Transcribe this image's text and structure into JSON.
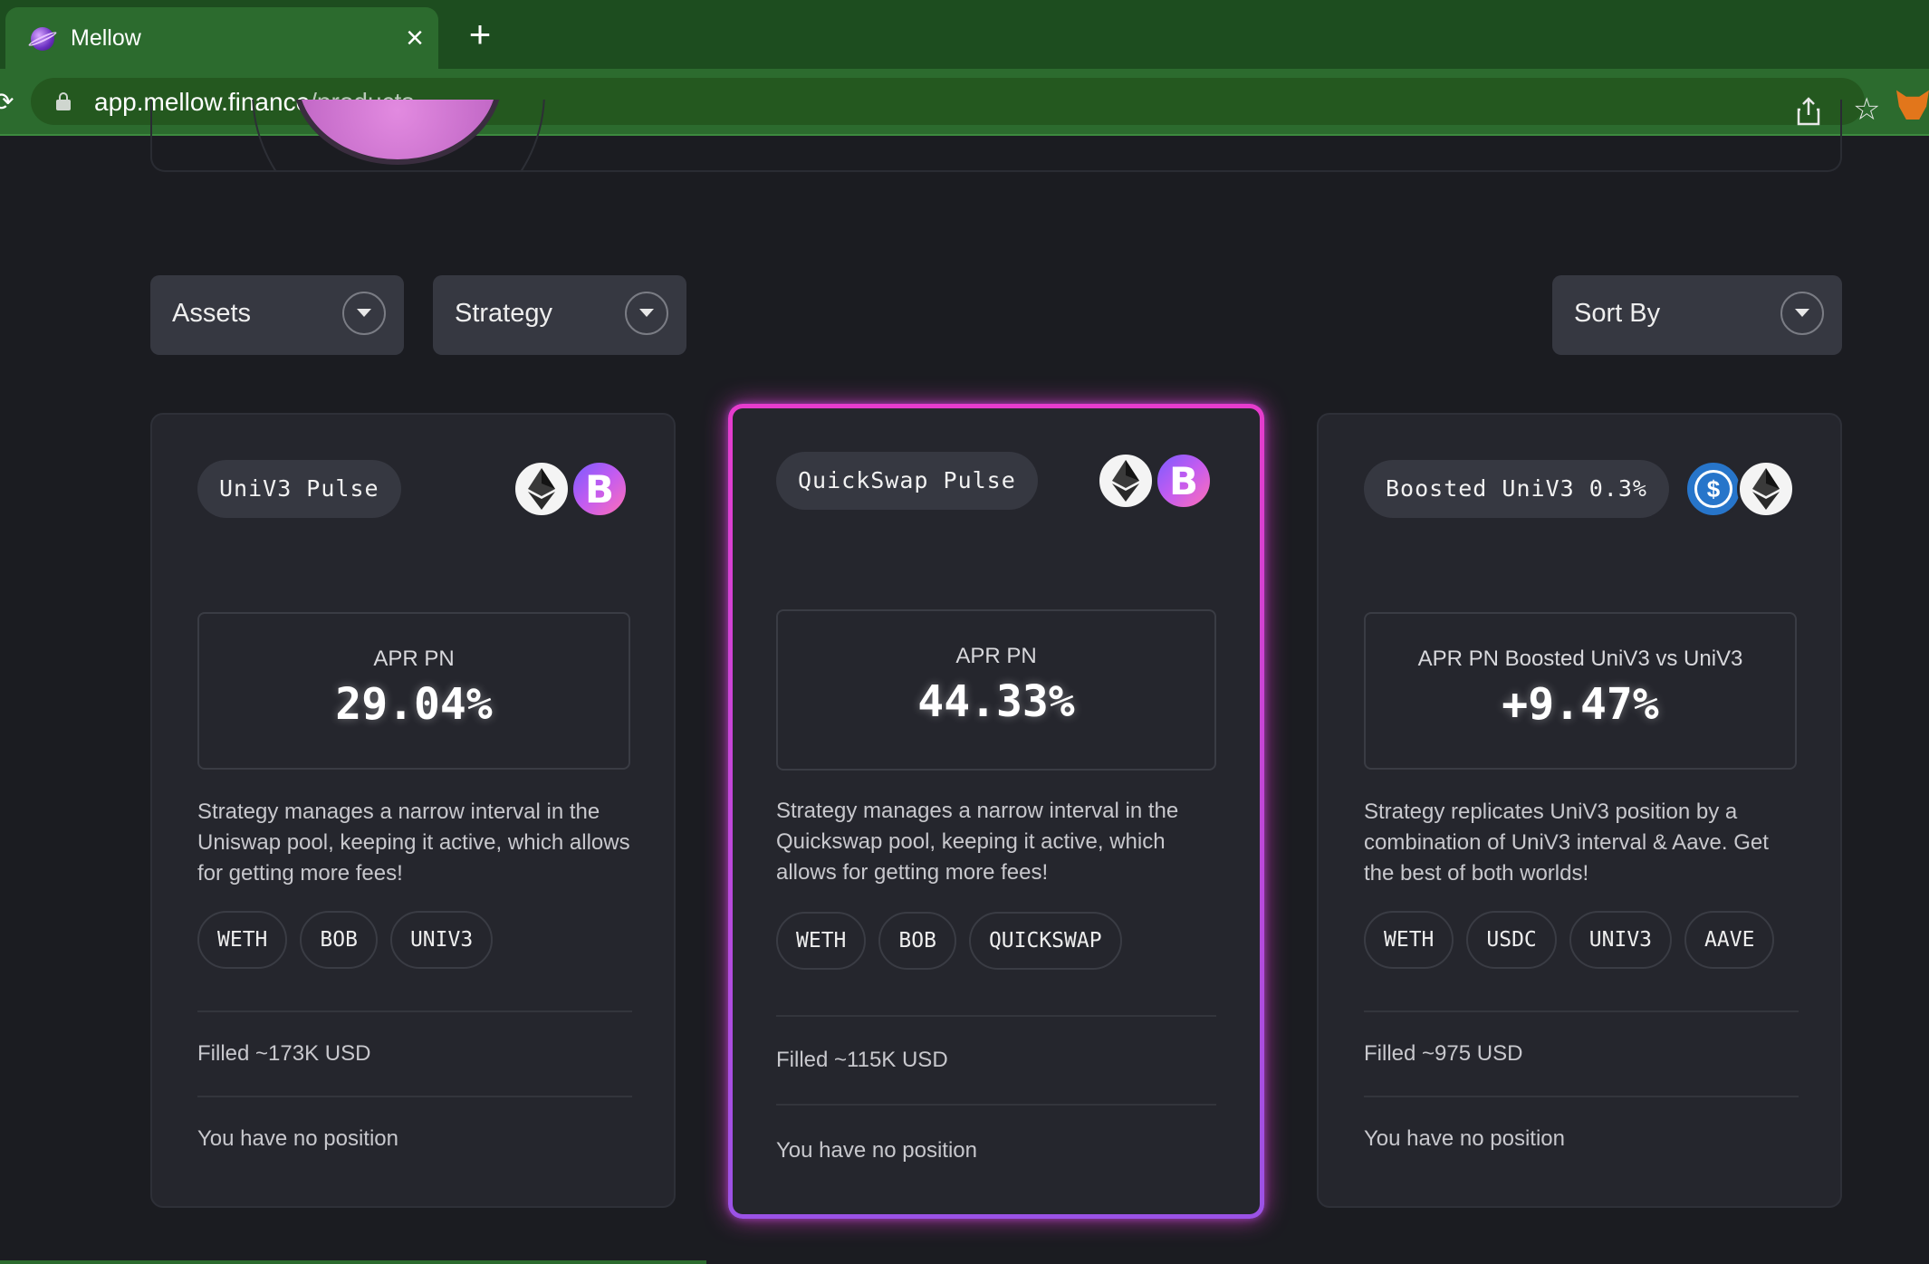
{
  "browser": {
    "tab_title": "Mellow",
    "tab_close": "×",
    "new_tab": "+",
    "url_host": "app.mellow.finance",
    "url_path": "/products"
  },
  "filters": {
    "assets": "Assets",
    "strategy": "Strategy",
    "sort_by": "Sort By"
  },
  "cards": [
    {
      "name": "UniV3 Pulse",
      "tokens": [
        "eth-icon",
        "bob-icon"
      ],
      "apr_label": "APR PN",
      "apr_value": "29.04%",
      "description": "Strategy manages a narrow interval in the Uniswap pool, keeping it active, which allows for getting more fees!",
      "tags": [
        "WETH",
        "BOB",
        "UNIV3"
      ],
      "filled": "Filled ~173K USD",
      "position": "You have no position"
    },
    {
      "name": "QuickSwap Pulse",
      "tokens": [
        "eth-icon",
        "bob-icon"
      ],
      "apr_label": "APR PN",
      "apr_value": "44.33%",
      "description": "Strategy manages a narrow interval in the Quickswap pool, keeping it active, which allows for getting more fees!",
      "tags": [
        "WETH",
        "BOB",
        "QUICKSWAP"
      ],
      "filled": "Filled ~115K USD",
      "position": "You have no position"
    },
    {
      "name": "Boosted UniV3 0.3%",
      "tokens": [
        "usdc-icon",
        "eth-icon"
      ],
      "apr_label": "APR PN Boosted UniV3 vs UniV3",
      "apr_value": "+9.47%",
      "description": "Strategy replicates UniV3 position by a combination of UniV3 interval & Aave. Get the best of both worlds!",
      "tags": [
        "WETH",
        "USDC",
        "UNIV3",
        "AAVE"
      ],
      "filled": "Filled ~975 USD",
      "position": "You have no position"
    }
  ],
  "colors": {
    "background": "#1b1c21",
    "card": "#25262d",
    "featured_border_top": "#e63ccd",
    "featured_border_bottom": "#9b52e6",
    "browser_green": "#2c6b2e"
  }
}
